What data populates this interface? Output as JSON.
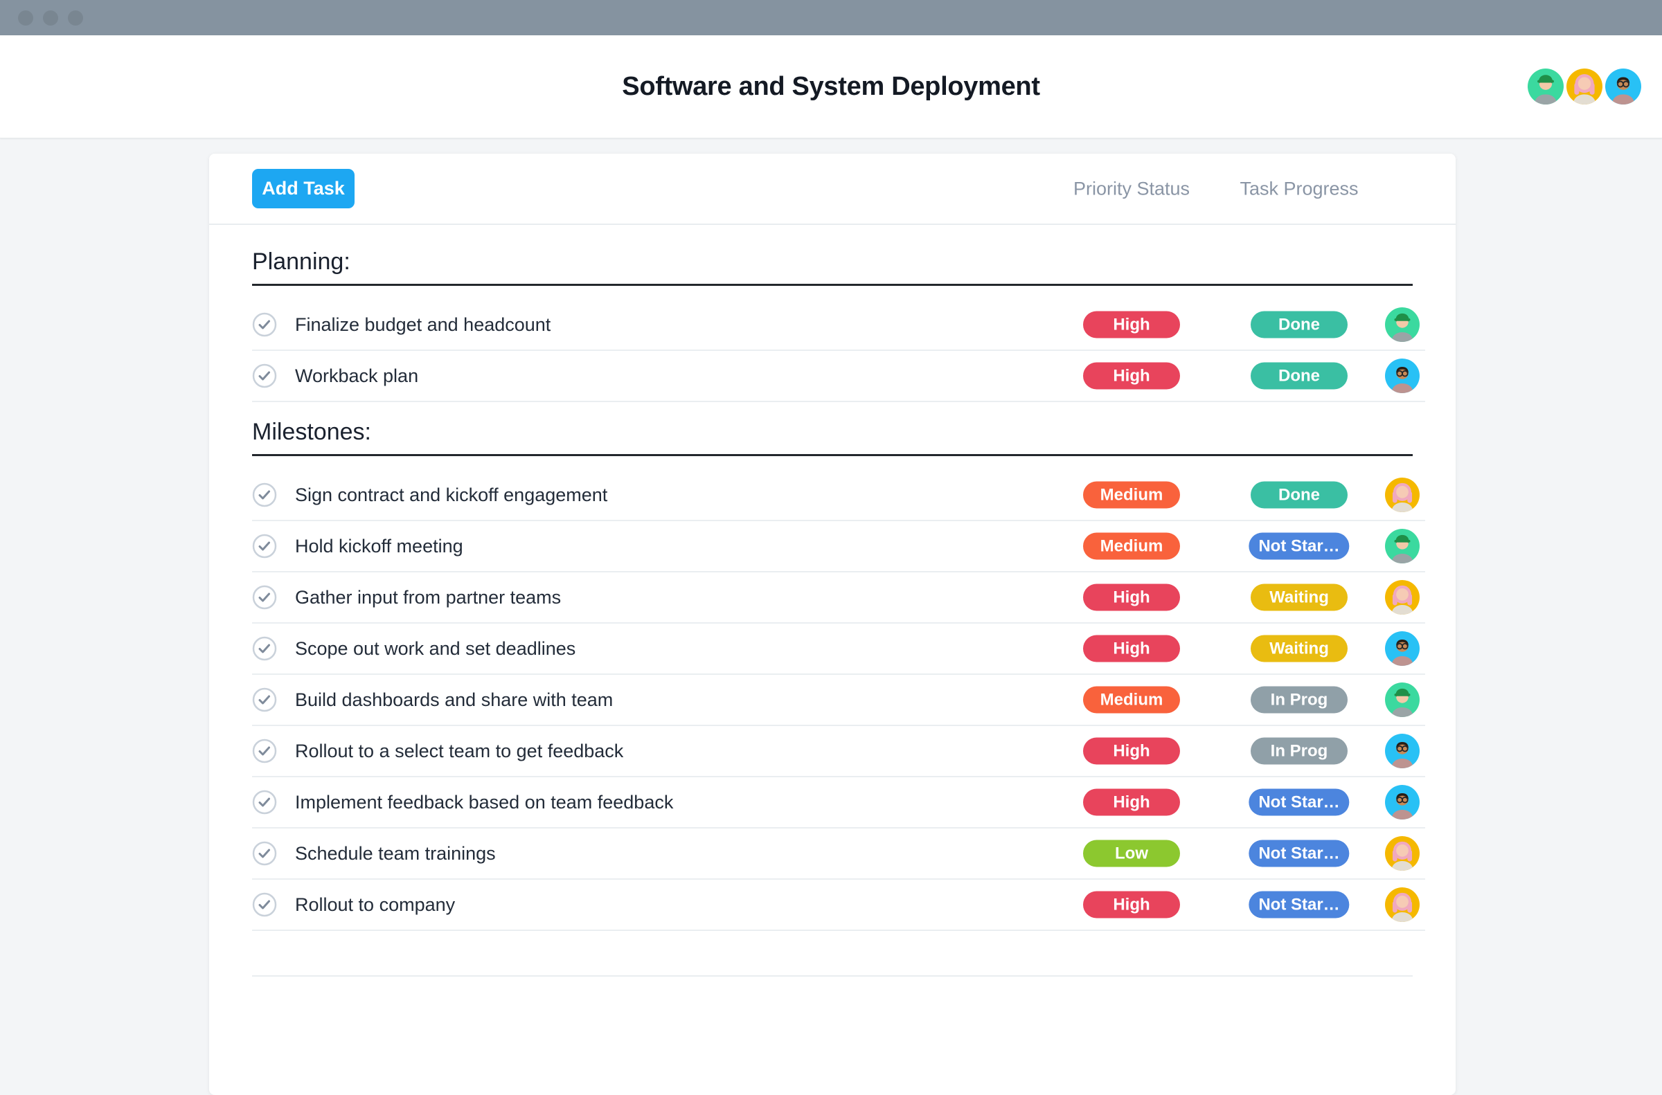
{
  "window": {
    "toolbar_color": "#8593A0"
  },
  "header": {
    "title": "Software and System Deployment",
    "avatars": [
      "green",
      "yellow",
      "blue"
    ]
  },
  "toolbar": {
    "add_task_label": "Add Task",
    "columns": [
      "Priority Status",
      "Task Progress"
    ]
  },
  "sections": [
    {
      "title": "Planning:",
      "tasks": [
        {
          "name": "Finalize budget and headcount",
          "priority": "High",
          "status": "Done",
          "assignee": "green"
        },
        {
          "name": "Workback plan",
          "priority": "High",
          "status": "Done",
          "assignee": "blue"
        }
      ]
    },
    {
      "title": "Milestones:",
      "tasks": [
        {
          "name": "Sign contract and kickoff engagement",
          "priority": "Medium",
          "status": "Done",
          "assignee": "yellow"
        },
        {
          "name": "Hold kickoff meeting",
          "priority": "Medium",
          "status": "Not Star…",
          "assignee": "green"
        },
        {
          "name": "Gather input from partner teams",
          "priority": "High",
          "status": "Waiting",
          "assignee": "yellow"
        },
        {
          "name": "Scope out work and set deadlines",
          "priority": "High",
          "status": "Waiting",
          "assignee": "blue"
        },
        {
          "name": "Build dashboards and share with team",
          "priority": "Medium",
          "status": "In Prog",
          "assignee": "green"
        },
        {
          "name": "Rollout to a select team to get feedback",
          "priority": "High",
          "status": "In Prog",
          "assignee": "blue"
        },
        {
          "name": "Implement feedback based on team feedback",
          "priority": "High",
          "status": "Not Star…",
          "assignee": "blue"
        },
        {
          "name": "Schedule team trainings",
          "priority": "Low",
          "status": "Not Star…",
          "assignee": "yellow"
        },
        {
          "name": "Rollout to company",
          "priority": "High",
          "status": "Not Star…",
          "assignee": "yellow"
        }
      ]
    }
  ],
  "colors": {
    "accent_blue": "#1DA7F2",
    "priority": {
      "High": "#E8445C",
      "Medium": "#F9623C",
      "Low": "#8CC82F"
    },
    "status": {
      "Done": "#3ABFA3",
      "Not Star…": "#4C85DE",
      "Waiting": "#E9BC11",
      "In Prog": "#90A0A8"
    }
  },
  "avatar_styles": {
    "green": {
      "bg": "#3BD99F",
      "skin": "#F2C9A8",
      "hair": "#4A3628",
      "shirt": "#9AA4A6",
      "hat": "#1F8F48"
    },
    "yellow": {
      "bg": "#F5B800",
      "skin": "#F6CBB5",
      "hair": "#F0A9BF",
      "shirt": "#E3DDD2",
      "long_hair": true
    },
    "blue": {
      "bg": "#28C1F5",
      "skin": "#C88A56",
      "hair": "#261E16",
      "shirt": "#BD9390",
      "glasses": true
    }
  }
}
